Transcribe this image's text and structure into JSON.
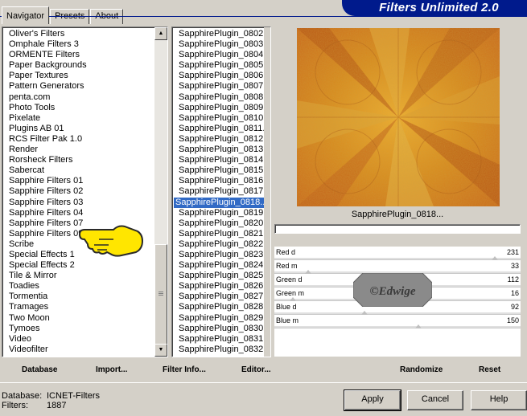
{
  "tabs": [
    "Navigator",
    "Presets",
    "About"
  ],
  "title": "Filters Unlimited 2.0",
  "categories": [
    "Oliver's Filters",
    "Omphale Filters 3",
    "ORMENTE Filters",
    "Paper Backgrounds",
    "Paper Textures",
    "Pattern Generators",
    "penta.com",
    "Photo Tools",
    "Pixelate",
    "Plugins AB 01",
    "RCS Filter Pak 1.0",
    "Render",
    "Rorsheck Filters",
    "Sabercat",
    "Sapphire Filters 01",
    "Sapphire Filters 02",
    "Sapphire Filters 03",
    "Sapphire Filters 04",
    "Sapphire Filters 07",
    "Sapphire Filters 09",
    "Scribe",
    "Special Effects 1",
    "Special Effects 2",
    "Tile & Mirror",
    "Toadies",
    "Tormentia",
    "Tramages",
    "Two Moon",
    "Tymoes",
    "Video",
    "Videofilter"
  ],
  "filters": [
    "SapphirePlugin_0802...",
    "SapphirePlugin_0803...",
    "SapphirePlugin_0804...",
    "SapphirePlugin_0805...",
    "SapphirePlugin_0806...",
    "SapphirePlugin_0807...",
    "SapphirePlugin_0808...",
    "SapphirePlugin_0809...",
    "SapphirePlugin_0810...",
    "SapphirePlugin_0811...",
    "SapphirePlugin_0812...",
    "SapphirePlugin_0813...",
    "SapphirePlugin_0814...",
    "SapphirePlugin_0815...",
    "SapphirePlugin_0816...",
    "SapphirePlugin_0817...",
    "SapphirePlugin_0818...",
    "SapphirePlugin_0819...",
    "SapphirePlugin_0820...",
    "SapphirePlugin_0821...",
    "SapphirePlugin_0822...",
    "SapphirePlugin_0823...",
    "SapphirePlugin_0824...",
    "SapphirePlugin_0825...",
    "SapphirePlugin_0826...",
    "SapphirePlugin_0827...",
    "SapphirePlugin_0828...",
    "SapphirePlugin_0829...",
    "SapphirePlugin_0830...",
    "SapphirePlugin_0831...",
    "SapphirePlugin_0832..."
  ],
  "selected_filter_index": 16,
  "preview_caption": "SapphirePlugin_0818...",
  "sliders": [
    {
      "label": "Red d",
      "value": "231",
      "level": 0.906
    },
    {
      "label": "Red m",
      "value": "33",
      "level": 0.129
    },
    {
      "label": "Green d",
      "value": "112",
      "level": 0.439
    },
    {
      "label": "Green m",
      "value": "16",
      "level": 0.063
    },
    {
      "label": "Blue d",
      "value": "92",
      "level": 0.361
    },
    {
      "label": "Blue m",
      "value": "150",
      "level": 0.588
    }
  ],
  "watermark": "©Edwige",
  "links": {
    "database": "Database",
    "import": "Import...",
    "filter_info": "Filter Info...",
    "editor": "Editor...",
    "randomize": "Randomize",
    "reset": "Reset"
  },
  "status": {
    "database_label": "Database:",
    "database_value": "ICNET-Filters",
    "filters_label": "Filters:",
    "filters_value": "1887"
  },
  "buttons": {
    "apply": "Apply",
    "cancel": "Cancel",
    "help": "Help"
  },
  "colors": {
    "banner": "#001a8c",
    "selection": "#316ac5",
    "pointer_hand": "#ffe600"
  }
}
